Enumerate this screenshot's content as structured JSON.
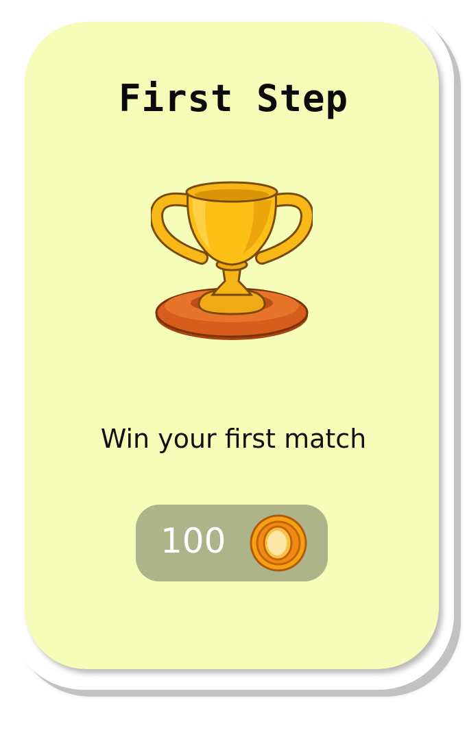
{
  "achievement": {
    "title": "First Step",
    "description": "Win your first match",
    "reward": {
      "amount": "100",
      "currency_icon": "coin-icon"
    },
    "badge_icon": "trophy-icon"
  },
  "colors": {
    "panel": "#f5fdb8",
    "card": "#ffffff",
    "card_shadow": "#c2c2c2",
    "reward_pill": "#adb48a",
    "trophy_gold": "#fcbf15",
    "trophy_base": "#e0641c",
    "coin_orange": "#f39a12"
  }
}
